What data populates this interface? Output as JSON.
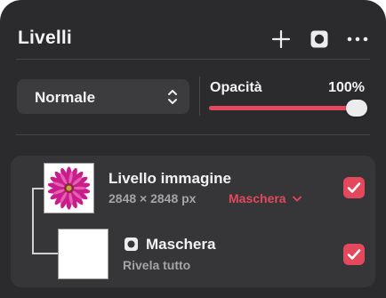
{
  "panel": {
    "title": "Livelli",
    "actions": [
      {
        "name": "add",
        "icon": "plus-icon"
      },
      {
        "name": "mask",
        "icon": "mask-icon"
      },
      {
        "name": "more",
        "icon": "ellipsis-icon"
      }
    ]
  },
  "blend": {
    "selected": "Normale",
    "icon": "chevron-up-down-icon"
  },
  "opacity": {
    "label": "Opacità",
    "value_text": "100%",
    "value": 1.0
  },
  "layers": [
    {
      "name": "Livello immagine",
      "info": "2848 × 2848 px",
      "mask_link": "Maschera",
      "thumbnail": "pink-flower",
      "visible": true
    },
    {
      "name": "Maschera",
      "subtitle": "Rivela tutto",
      "icon": "mask-icon",
      "thumbnail": "white",
      "visible": true
    }
  ],
  "colors": {
    "accent": "#e4485c",
    "panel_bg": "#2b2b2d",
    "box_bg": "#363638",
    "secondary_text": "#a4a4a6"
  }
}
